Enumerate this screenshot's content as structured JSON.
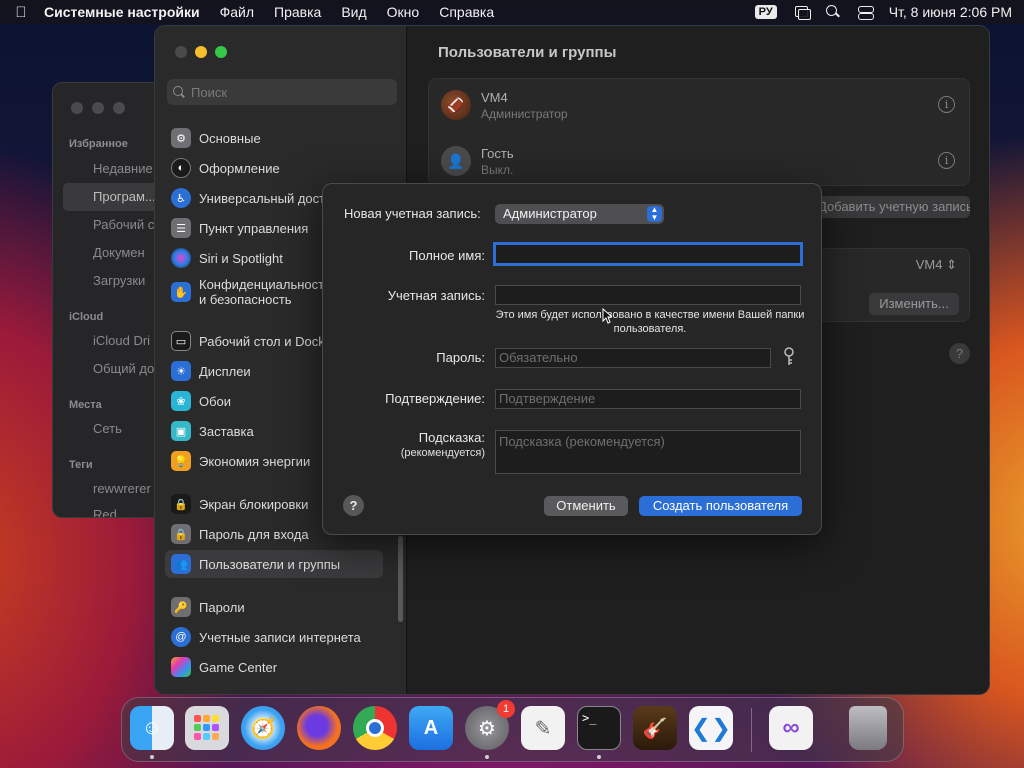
{
  "menubar": {
    "app_name": "Системные настройки",
    "items": [
      "Файл",
      "Правка",
      "Вид",
      "Окно",
      "Справка"
    ],
    "input_lang": "РУ",
    "datetime": "Чт, 8 июня  2:06 PM"
  },
  "finder": {
    "sections": {
      "favorites": "Избранное",
      "icloud": "iCloud",
      "places": "Места",
      "tags": "Теги"
    },
    "items": {
      "recent": "Недавние",
      "apps": "Програм...",
      "desktop": "Рабочий с",
      "documents": "Докумен",
      "downloads": "Загрузки",
      "icloud_drive": "iCloud Dri",
      "shared": "Общий до",
      "network": "Сеть",
      "tag1": "rewwrerer",
      "tag2": "Red"
    }
  },
  "sidebar": {
    "search_placeholder": "Поиск",
    "items": [
      {
        "label": "Основные"
      },
      {
        "label": "Оформление"
      },
      {
        "label": "Универсальный доступ"
      },
      {
        "label": "Пункт управления"
      },
      {
        "label": "Siri и Spotlight"
      },
      {
        "label": "Конфиденциальность и безопасность"
      },
      {
        "label": "Рабочий стол и Dock"
      },
      {
        "label": "Дисплеи"
      },
      {
        "label": "Обои"
      },
      {
        "label": "Заставка"
      },
      {
        "label": "Экономия энергии"
      },
      {
        "label": "Экран блокировки"
      },
      {
        "label": "Пароль для входа"
      },
      {
        "label": "Пользователи и группы"
      },
      {
        "label": "Пароли"
      },
      {
        "label": "Учетные записи интернета"
      },
      {
        "label": "Game Center"
      }
    ]
  },
  "content": {
    "title": "Пользователи и группы",
    "users": [
      {
        "name": "VM4",
        "role": "Администратор"
      },
      {
        "name": "Гость",
        "role": "Выкл."
      }
    ],
    "add_account_label": "Добавить учетную запись...",
    "auto_login_value": "VM4",
    "change_label": "Изменить...",
    "help": "?"
  },
  "dialog": {
    "account_type_label": "Новая учетная запись:",
    "account_type_value": "Администратор",
    "full_name_label": "Полное имя:",
    "full_name_value": "",
    "account_name_label": "Учетная запись:",
    "account_name_value": "",
    "account_name_hint": "Это имя будет использовано в качестве имени Вашей папки пользователя.",
    "password_label": "Пароль:",
    "password_placeholder": "Обязательно",
    "verify_label": "Подтверждение:",
    "verify_placeholder": "Подтверждение",
    "hint_label": "Подсказка:",
    "hint_sublabel": "(рекомендуется)",
    "hint_placeholder": "Подсказка (рекомендуется)",
    "help": "?",
    "cancel_label": "Отменить",
    "create_label": "Создать пользователя"
  },
  "dock": {
    "apps": [
      "Finder",
      "Launchpad",
      "Safari",
      "Firefox",
      "Chrome",
      "App Store",
      "System Settings",
      "TextEdit",
      "Terminal",
      "GarageBand",
      "VS Code",
      "Visual Studio",
      "Trash"
    ],
    "settings_badge": "1",
    "terminal_prompt": ">_"
  },
  "colors": {
    "accent": "#2b6fd6",
    "window_bg": "#1e1e1e",
    "sidebar_bg": "#2a2a2b"
  }
}
